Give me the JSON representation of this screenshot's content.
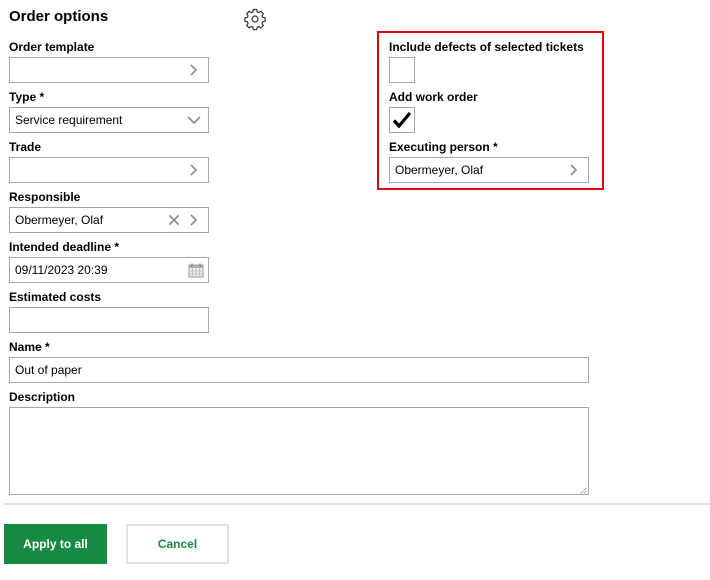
{
  "header": {
    "title": "Order options",
    "settings_icon": "gear-icon"
  },
  "form": {
    "order_template": {
      "label": "Order template",
      "value": ""
    },
    "type": {
      "label": "Type *",
      "value": "Service requirement"
    },
    "trade": {
      "label": "Trade",
      "value": ""
    },
    "responsible": {
      "label": "Responsible",
      "value": "Obermeyer, Olaf"
    },
    "intended_deadline": {
      "label": "Intended deadline *",
      "value": "09/11/2023 20:39"
    },
    "estimated_costs": {
      "label": "Estimated costs",
      "value": ""
    },
    "name": {
      "label": "Name *",
      "value": "Out of paper"
    },
    "description": {
      "label": "Description",
      "value": ""
    }
  },
  "options": {
    "include_defects": {
      "label": "Include defects of selected tickets",
      "checked": false
    },
    "add_work_order": {
      "label": "Add work order",
      "checked": true
    },
    "executing_person": {
      "label": "Executing person *",
      "value": "Obermeyer, Olaf"
    }
  },
  "actions": {
    "apply_label": "Apply to all",
    "cancel_label": "Cancel"
  },
  "colors": {
    "primary": "#178a44",
    "highlight": "#e3000f"
  }
}
